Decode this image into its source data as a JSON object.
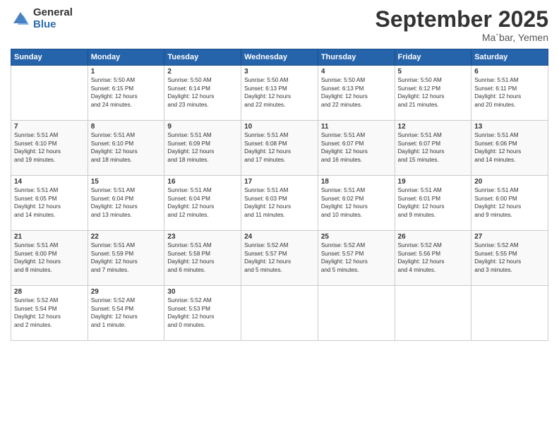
{
  "logo": {
    "general": "General",
    "blue": "Blue"
  },
  "title": "September 2025",
  "location": "Ma`bar, Yemen",
  "days_header": [
    "Sunday",
    "Monday",
    "Tuesday",
    "Wednesday",
    "Thursday",
    "Friday",
    "Saturday"
  ],
  "weeks": [
    [
      {
        "day": "",
        "info": ""
      },
      {
        "day": "1",
        "info": "Sunrise: 5:50 AM\nSunset: 6:15 PM\nDaylight: 12 hours\nand 24 minutes."
      },
      {
        "day": "2",
        "info": "Sunrise: 5:50 AM\nSunset: 6:14 PM\nDaylight: 12 hours\nand 23 minutes."
      },
      {
        "day": "3",
        "info": "Sunrise: 5:50 AM\nSunset: 6:13 PM\nDaylight: 12 hours\nand 22 minutes."
      },
      {
        "day": "4",
        "info": "Sunrise: 5:50 AM\nSunset: 6:13 PM\nDaylight: 12 hours\nand 22 minutes."
      },
      {
        "day": "5",
        "info": "Sunrise: 5:50 AM\nSunset: 6:12 PM\nDaylight: 12 hours\nand 21 minutes."
      },
      {
        "day": "6",
        "info": "Sunrise: 5:51 AM\nSunset: 6:11 PM\nDaylight: 12 hours\nand 20 minutes."
      }
    ],
    [
      {
        "day": "7",
        "info": "Sunrise: 5:51 AM\nSunset: 6:10 PM\nDaylight: 12 hours\nand 19 minutes."
      },
      {
        "day": "8",
        "info": "Sunrise: 5:51 AM\nSunset: 6:10 PM\nDaylight: 12 hours\nand 18 minutes."
      },
      {
        "day": "9",
        "info": "Sunrise: 5:51 AM\nSunset: 6:09 PM\nDaylight: 12 hours\nand 18 minutes."
      },
      {
        "day": "10",
        "info": "Sunrise: 5:51 AM\nSunset: 6:08 PM\nDaylight: 12 hours\nand 17 minutes."
      },
      {
        "day": "11",
        "info": "Sunrise: 5:51 AM\nSunset: 6:07 PM\nDaylight: 12 hours\nand 16 minutes."
      },
      {
        "day": "12",
        "info": "Sunrise: 5:51 AM\nSunset: 6:07 PM\nDaylight: 12 hours\nand 15 minutes."
      },
      {
        "day": "13",
        "info": "Sunrise: 5:51 AM\nSunset: 6:06 PM\nDaylight: 12 hours\nand 14 minutes."
      }
    ],
    [
      {
        "day": "14",
        "info": "Sunrise: 5:51 AM\nSunset: 6:05 PM\nDaylight: 12 hours\nand 14 minutes."
      },
      {
        "day": "15",
        "info": "Sunrise: 5:51 AM\nSunset: 6:04 PM\nDaylight: 12 hours\nand 13 minutes."
      },
      {
        "day": "16",
        "info": "Sunrise: 5:51 AM\nSunset: 6:04 PM\nDaylight: 12 hours\nand 12 minutes."
      },
      {
        "day": "17",
        "info": "Sunrise: 5:51 AM\nSunset: 6:03 PM\nDaylight: 12 hours\nand 11 minutes."
      },
      {
        "day": "18",
        "info": "Sunrise: 5:51 AM\nSunset: 6:02 PM\nDaylight: 12 hours\nand 10 minutes."
      },
      {
        "day": "19",
        "info": "Sunrise: 5:51 AM\nSunset: 6:01 PM\nDaylight: 12 hours\nand 9 minutes."
      },
      {
        "day": "20",
        "info": "Sunrise: 5:51 AM\nSunset: 6:00 PM\nDaylight: 12 hours\nand 9 minutes."
      }
    ],
    [
      {
        "day": "21",
        "info": "Sunrise: 5:51 AM\nSunset: 6:00 PM\nDaylight: 12 hours\nand 8 minutes."
      },
      {
        "day": "22",
        "info": "Sunrise: 5:51 AM\nSunset: 5:59 PM\nDaylight: 12 hours\nand 7 minutes."
      },
      {
        "day": "23",
        "info": "Sunrise: 5:51 AM\nSunset: 5:58 PM\nDaylight: 12 hours\nand 6 minutes."
      },
      {
        "day": "24",
        "info": "Sunrise: 5:52 AM\nSunset: 5:57 PM\nDaylight: 12 hours\nand 5 minutes."
      },
      {
        "day": "25",
        "info": "Sunrise: 5:52 AM\nSunset: 5:57 PM\nDaylight: 12 hours\nand 5 minutes."
      },
      {
        "day": "26",
        "info": "Sunrise: 5:52 AM\nSunset: 5:56 PM\nDaylight: 12 hours\nand 4 minutes."
      },
      {
        "day": "27",
        "info": "Sunrise: 5:52 AM\nSunset: 5:55 PM\nDaylight: 12 hours\nand 3 minutes."
      }
    ],
    [
      {
        "day": "28",
        "info": "Sunrise: 5:52 AM\nSunset: 5:54 PM\nDaylight: 12 hours\nand 2 minutes."
      },
      {
        "day": "29",
        "info": "Sunrise: 5:52 AM\nSunset: 5:54 PM\nDaylight: 12 hours\nand 1 minute."
      },
      {
        "day": "30",
        "info": "Sunrise: 5:52 AM\nSunset: 5:53 PM\nDaylight: 12 hours\nand 0 minutes."
      },
      {
        "day": "",
        "info": ""
      },
      {
        "day": "",
        "info": ""
      },
      {
        "day": "",
        "info": ""
      },
      {
        "day": "",
        "info": ""
      }
    ]
  ]
}
